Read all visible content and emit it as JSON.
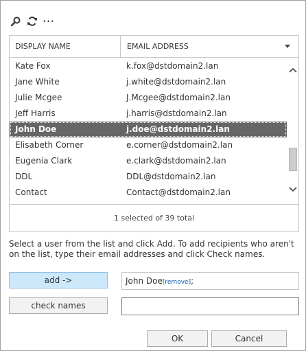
{
  "toolbar": {
    "search_icon": "search-icon",
    "refresh_icon": "refresh-icon",
    "more_label": "•••"
  },
  "grid": {
    "columns": [
      "DISPLAY NAME",
      "EMAIL ADDRESS"
    ],
    "rows": [
      {
        "name": "Kate Fox",
        "email": "k.fox@dstdomain2.lan"
      },
      {
        "name": "Jane White",
        "email": "j.white@dstdomain2.lan"
      },
      {
        "name": "Julie Mcgee",
        "email": "J.Mcgee@dstdomain2.lan"
      },
      {
        "name": "Jeff Harris",
        "email": "j.harris@dstdomain2.lan"
      },
      {
        "name": "John Doe",
        "email": "j.doe@dstdomain2.lan"
      },
      {
        "name": "Elisabeth Corner",
        "email": "e.corner@dstdomain2.lan"
      },
      {
        "name": "Eugenia Clark",
        "email": "e.clark@dstdomain2.lan"
      },
      {
        "name": "DDL",
        "email": "DDL@dstdomain2.lan"
      },
      {
        "name": "Contact",
        "email": "Contact@dstdomain2.lan"
      }
    ],
    "selected_index": 4,
    "footer": "1 selected of 39 total"
  },
  "instructions": "Select a user from the list and click Add. To add recipients who aren't on the list, type their email addresses and click Check names.",
  "buttons": {
    "add": "add ->",
    "check_names": "check names",
    "ok": "OK",
    "cancel": "Cancel"
  },
  "recipients": {
    "name": "John Doe",
    "remove_label": "[remove]",
    "separator": ";"
  },
  "name_input": {
    "value": ""
  },
  "colors": {
    "selected_row": "#666666",
    "add_button": "#cde8fb",
    "remove_link": "#0a58b5"
  }
}
